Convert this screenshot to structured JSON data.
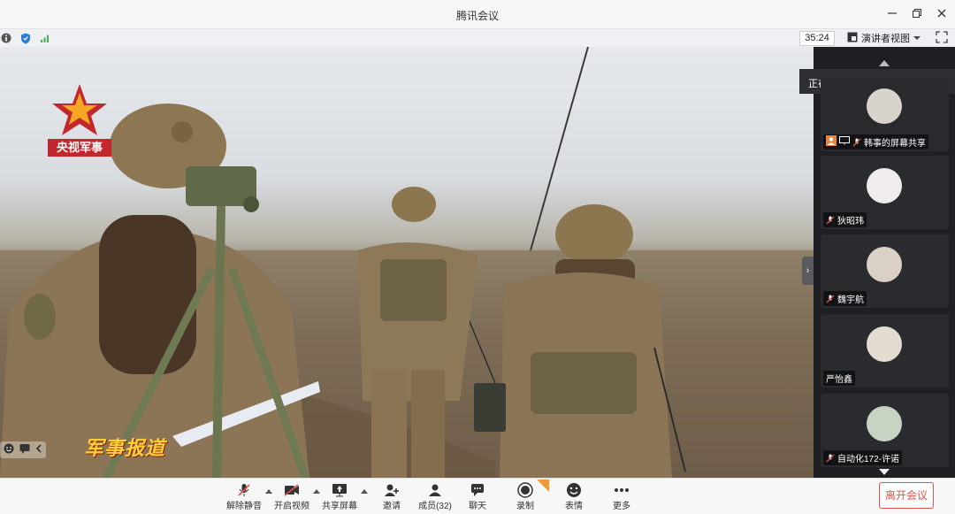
{
  "window": {
    "title": "腾讯会议"
  },
  "status": {
    "timer": "35:24",
    "view_label": "演讲者视图"
  },
  "video": {
    "channel_label": "央视军事",
    "program_logo": "军事报道"
  },
  "side": {
    "speaking_label": "正在讲话:",
    "participants": [
      {
        "name": "韩事的屏幕共享"
      },
      {
        "name": "狄昭玮"
      },
      {
        "name": "魏宇航"
      },
      {
        "name": "严怡鑫"
      },
      {
        "name": "自动化172-许诺"
      }
    ]
  },
  "toolbar": {
    "unmute": "解除静音",
    "start_video": "开启视频",
    "share_screen": "共享屏幕",
    "invite": "邀请",
    "members": "成员(32)",
    "chat": "聊天",
    "record": "录制",
    "reactions": "表情",
    "more": "更多",
    "leave": "离开会议"
  },
  "icons": [
    "info-icon",
    "shield-icon",
    "signal-icon",
    "minimize-icon",
    "restore-icon",
    "close-icon",
    "fullscreen-icon",
    "grid-view-icon"
  ],
  "colors": {
    "leave": "#e0524c",
    "cctv_red": "#c1272d",
    "shield_blue": "#2a7ae2",
    "signal_green": "#3bb54a"
  }
}
